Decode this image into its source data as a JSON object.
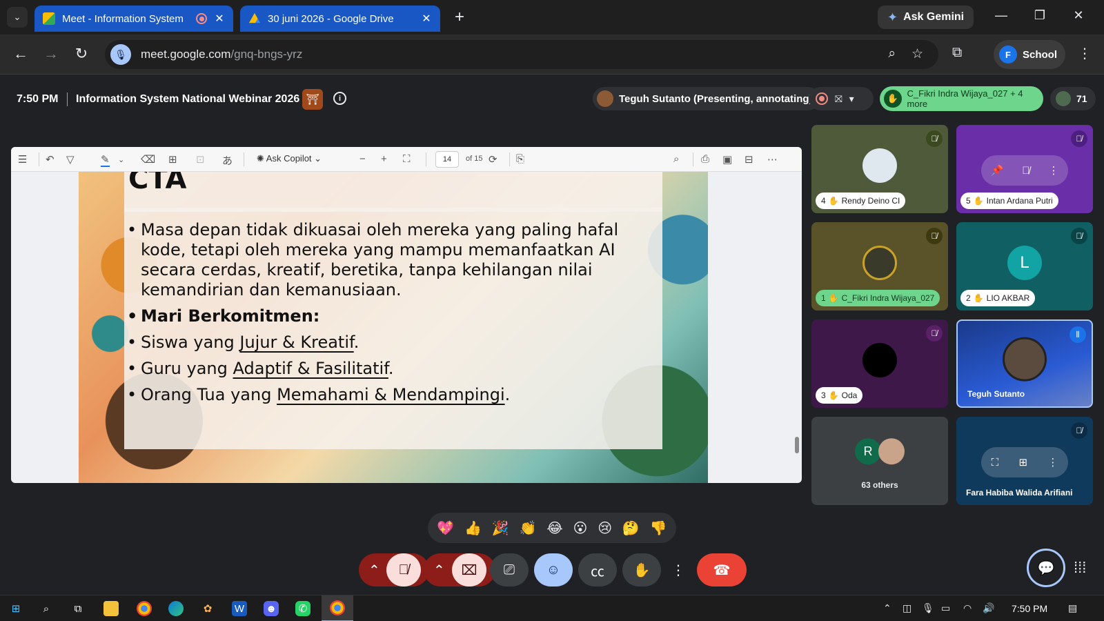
{
  "browser": {
    "tabs": [
      {
        "title": "Meet - Information System",
        "close": "✕"
      },
      {
        "title": "30 juni 2026 - Google Drive",
        "close": "✕"
      }
    ],
    "new_tab": "+",
    "gemini_label": "Ask Gemini",
    "url_host": "meet.google.com",
    "url_path": "/gnq-bngs-yrz",
    "profile_initial": "F",
    "profile_label": "School"
  },
  "meet": {
    "time": "7:50 PM",
    "title": "Information System National Webinar 2026",
    "presenter": "Teguh Sutanto (Presenting, annotating)",
    "hand_raised": "C_Fikri Indra Wijaya_027 + 4 more",
    "participant_count": "71"
  },
  "pdf": {
    "copilot_label": "Ask Copilot",
    "page": "14",
    "of_pages": "of 15"
  },
  "slide": {
    "heading": "CTA",
    "bullets": [
      {
        "text": "Masa depan tidak dikuasai oleh mereka yang paling hafal kode, tetapi oleh mereka yang mampu memanfaatkan AI secara cerdas, kreatif, beretika, tanpa kehilangan nilai kemandirian dan kemanusiaan."
      },
      {
        "text": "Mari Berkomitmen:"
      },
      {
        "prefix": "Siswa yang ",
        "emph": "Jujur & Kreatif",
        "suffix": "."
      },
      {
        "prefix": "Guru yang ",
        "emph": "Adaptif & Fasilitatif",
        "suffix": "."
      },
      {
        "prefix": "Orang Tua yang ",
        "emph": "Memahami & Mendampingi",
        "suffix": "."
      }
    ]
  },
  "participants": [
    {
      "index": "4",
      "name": "Rendy Deino CI",
      "muted": true
    },
    {
      "index": "5",
      "name": "Intan Ardana Putri",
      "muted": true
    },
    {
      "index": "1",
      "name": "C_Fikri Indra Wijaya_027",
      "muted": true,
      "hand_raised": true
    },
    {
      "index": "2",
      "name": "LIO AKBAR",
      "muted": true,
      "avatar_letter": "L",
      "avatar_color": "#12a4a4"
    },
    {
      "index": "3",
      "name": "Oda",
      "muted": true
    },
    {
      "name": "Teguh Sutanto",
      "presenting": true
    },
    {
      "others_letter": "R",
      "others_label": "63 others"
    },
    {
      "name": "Fara Habiba Walida Arifiani",
      "muted": true
    }
  ],
  "reactions": [
    "💖",
    "👍",
    "🎉",
    "👏",
    "😂",
    "😮",
    "😢",
    "🤔",
    "👎"
  ],
  "taskbar": {
    "time": "7:50 PM"
  },
  "colors": {
    "tab_active": "#1857c4",
    "meet_bg": "#202124",
    "hand_green": "#6dd58c",
    "end_call": "#ea4335",
    "cam_off": "#f9dedc",
    "emoji_active": "#a8c7fa"
  }
}
